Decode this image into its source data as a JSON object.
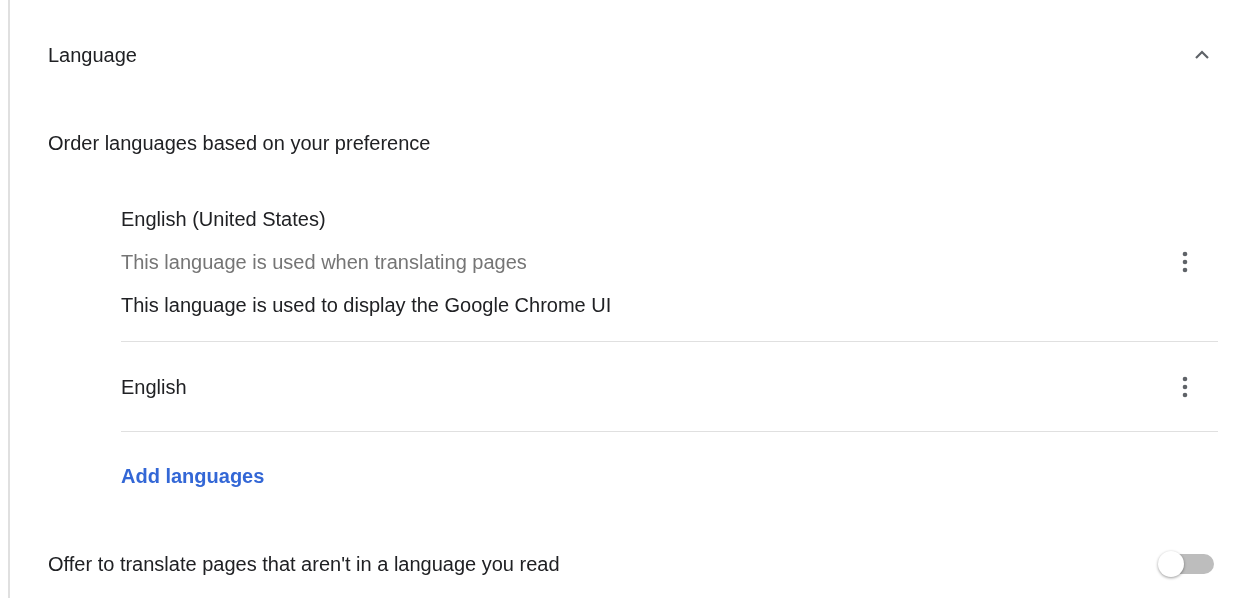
{
  "section": {
    "title": "Language",
    "expanded": true
  },
  "subtitle": "Order languages based on your preference",
  "languages": [
    {
      "name": "English (United States)",
      "notes": [
        {
          "text": "This language is used when translating pages",
          "secondary": true
        },
        {
          "text": "This language is used to display the Google Chrome UI",
          "secondary": false
        }
      ]
    },
    {
      "name": "English"
    }
  ],
  "add_link": "Add languages",
  "translate_offer": {
    "label": "Offer to translate pages that aren't in a language you read",
    "on": false
  }
}
